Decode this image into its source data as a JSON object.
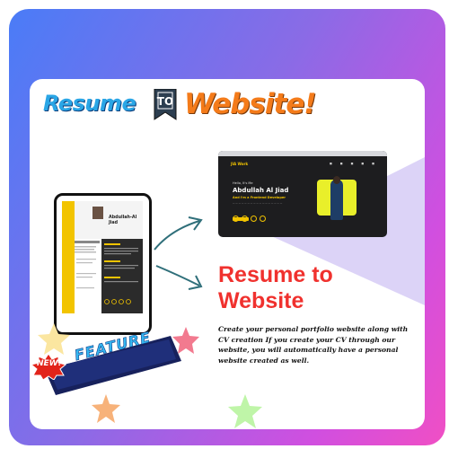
{
  "title": {
    "part1": "Resume",
    "connector": "TO",
    "part2": "Website!"
  },
  "headline": {
    "line1": "Resume to",
    "line2": "Website"
  },
  "description": "Create your personal portfolio website along with CV creation If you create your CV through our website, you will automatically have a personal website created as well.",
  "badge": {
    "new": "NEW!",
    "feature": "FEATURE"
  },
  "resume_preview": {
    "name": "Abdullah-Al Jiad"
  },
  "website_preview": {
    "brand": "JIA Work",
    "greeting": "Hello, It's Me",
    "name": "Abdullah Al Jiad",
    "role": "And I'm a Frontend Developer"
  },
  "colors": {
    "headline": "#f0312e",
    "title_resume": "#2aa6e6",
    "title_website": "#f47b1a",
    "accent_yellow": "#f2c400",
    "gradient_start": "#4a7cf7",
    "gradient_end": "#f04fc4"
  }
}
